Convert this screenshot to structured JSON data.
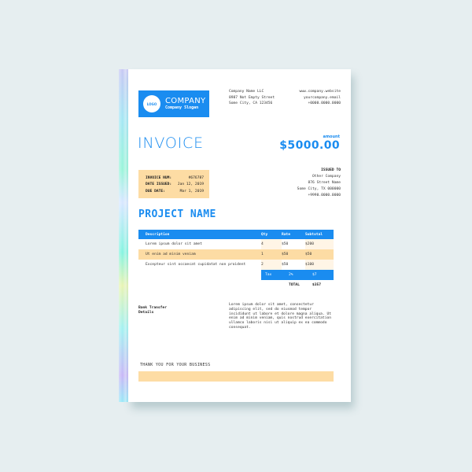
{
  "company": {
    "logo_label": "LOGO",
    "name": "COMPANY",
    "slogan": "Company Slogan",
    "address_lines": [
      "Company Name LLC",
      "8987 Not Empty Street",
      "Some City, CA 123456"
    ],
    "contact_lines": [
      "www.company.website",
      "yourcompany.email",
      "+0000.0000.0000"
    ]
  },
  "invoice": {
    "title": "INVOICE",
    "amount_label": "amount",
    "amount_value": "$5000.00",
    "meta": [
      {
        "key": "INVOICE NUM:",
        "value": "#676787"
      },
      {
        "key": "DATE ISSUED:",
        "value": "Jan 12, 2019"
      },
      {
        "key": "DUE DATE:",
        "value": "Mar 1, 2019"
      }
    ]
  },
  "issued_to": {
    "heading": "ISSUED TO",
    "lines": [
      "Other Company",
      "876 Street Name",
      "Some City, TX 000000",
      "+9990.0000.0000"
    ]
  },
  "project": {
    "title": "PROJECT NAME"
  },
  "table": {
    "headers": [
      "Description",
      "Qty",
      "Rate",
      "Subtotal"
    ],
    "rows": [
      {
        "description": "Lorem ipsum dolor sit amet",
        "qty": "4",
        "rate": "$50",
        "subtotal": "$200"
      },
      {
        "description": "Ut enim ad minim veniam",
        "qty": "1",
        "rate": "$50",
        "subtotal": "$50"
      },
      {
        "description": "Excepteur sint occaecat cupidatat non proident",
        "qty": "2",
        "rate": "$50",
        "subtotal": "$100"
      }
    ],
    "tax": {
      "label": "Tax",
      "rate": "2%",
      "amount": "$7"
    },
    "total": {
      "label": "TOTAL",
      "amount": "$357"
    }
  },
  "payment": {
    "heading_lines": [
      "Bank Transfer",
      "Details"
    ],
    "notes": "Lorem ipsum dolor sit amet, consectetur adipiscing elit, sed do eiusmod tempor incididunt ut labore et dolore magna aliqua. Ut enim ad minim veniam, quis nostrud exercitation ullamco laboris nisi ut aliquip ex ea commodo consequat."
  },
  "footer": {
    "thanks": "THANK YOU FOR YOUR BUSINESS"
  },
  "colors": {
    "accent": "#1a8cf0",
    "highlight": "#fddca4",
    "background": "#e6eef0"
  }
}
